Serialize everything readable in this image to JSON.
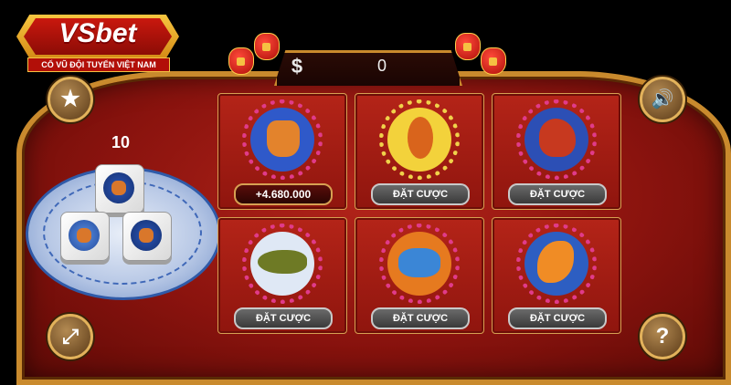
{
  "logo": {
    "brand": "VSbet",
    "slogan": "CỔ VŨ ĐỘI TUYỂN VIỆT NAM"
  },
  "topbar": {
    "currency_symbol": "$",
    "balance": "0"
  },
  "dice_count": "10",
  "icons": {
    "star": "★",
    "sound": "🔊",
    "stats": "⤢",
    "help": "?"
  },
  "cells": [
    {
      "animal": "deer",
      "bet_label": "+4.680.000",
      "is_win": true
    },
    {
      "animal": "gourd",
      "bet_label": "ĐẶT CƯỢC",
      "is_win": false
    },
    {
      "animal": "rooster",
      "bet_label": "ĐẶT CƯỢC",
      "is_win": false
    },
    {
      "animal": "fish",
      "bet_label": "ĐẶT CƯỢC",
      "is_win": false
    },
    {
      "animal": "crab",
      "bet_label": "ĐẶT CƯỢC",
      "is_win": false
    },
    {
      "animal": "shrimp",
      "bet_label": "ĐẶT CƯỢC",
      "is_win": false
    }
  ],
  "dice": [
    "deer",
    "crab",
    "deer"
  ],
  "colors": {
    "accent_gold": "#c98a2d",
    "table_red": "#8a130e"
  }
}
